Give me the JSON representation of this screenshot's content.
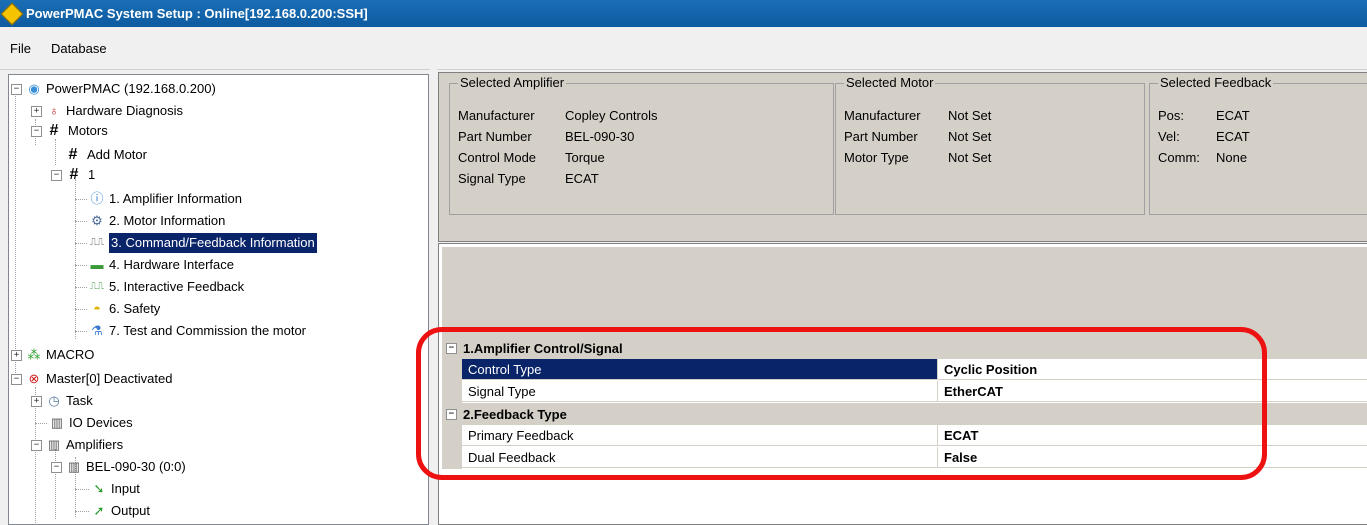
{
  "window": {
    "title": "PowerPMAC System Setup : Online[192.168.0.200:SSH]"
  },
  "menu": {
    "file": "File",
    "database": "Database"
  },
  "tree": {
    "root": "PowerPMAC (192.168.0.200)",
    "hardware_diagnosis": "Hardware Diagnosis",
    "motors": "Motors",
    "add_motor": "Add Motor",
    "motor_1": "1",
    "motor_items": [
      "1. Amplifier Information",
      "2. Motor Information",
      "3. Command/Feedback Information",
      "4. Hardware Interface",
      "5. Interactive Feedback",
      "6. Safety",
      "7. Test and Commission the motor"
    ],
    "macro": "MACRO",
    "master": "Master[0] Deactivated",
    "task": "Task",
    "io_devices": "IO Devices",
    "amplifiers": "Amplifiers",
    "amp_node": "BEL-090-30 (0:0)",
    "input": "Input",
    "output": "Output"
  },
  "selected_amplifier": {
    "title": "Selected Amplifier",
    "rows": [
      {
        "label": "Manufacturer",
        "value": "Copley Controls"
      },
      {
        "label": "Part Number",
        "value": "BEL-090-30"
      },
      {
        "label": "Control Mode",
        "value": "Torque"
      },
      {
        "label": "Signal Type",
        "value": "ECAT"
      }
    ]
  },
  "selected_motor": {
    "title": "Selected Motor",
    "rows": [
      {
        "label": "Manufacturer",
        "value": "Not Set"
      },
      {
        "label": "Part Number",
        "value": "Not Set"
      },
      {
        "label": "Motor Type",
        "value": "Not Set"
      }
    ]
  },
  "selected_feedback": {
    "title": "Selected Feedback",
    "rows": [
      {
        "label": "Pos:",
        "value": "ECAT"
      },
      {
        "label": "Vel:",
        "value": "ECAT"
      },
      {
        "label": "Comm:",
        "value": "None"
      }
    ]
  },
  "property_grid": {
    "cat1": "1.Amplifier Control/Signal",
    "control_type": {
      "name": "Control Type",
      "value": "Cyclic Position"
    },
    "signal_type": {
      "name": "Signal Type",
      "value": "EtherCAT"
    },
    "cat2": "2.Feedback Type",
    "primary_feedback": {
      "name": "Primary Feedback",
      "value": "ECAT"
    },
    "dual_feedback": {
      "name": "Dual Feedback",
      "value": "False"
    }
  },
  "colors": {
    "title_bar": "#1a6fb5",
    "selection": "#0a246a",
    "highlight_ring": "#ee1111"
  }
}
